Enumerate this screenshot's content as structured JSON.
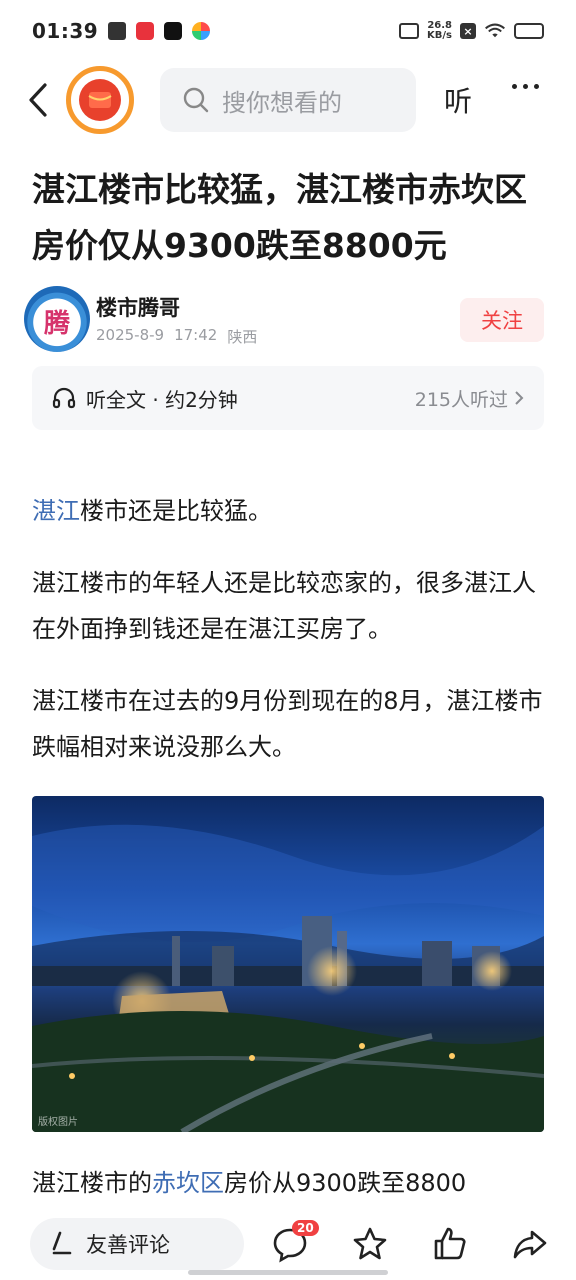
{
  "status_bar": {
    "time": "01:39",
    "speed_value": "26.8",
    "speed_unit": "KB/s"
  },
  "nav": {
    "search_placeholder": "搜你想看的",
    "listen_label": "听"
  },
  "article": {
    "title": "湛江楼市比较猛，湛江楼市赤坎区房价仅从9300跌至8800元",
    "author": {
      "name": "楼市腾哥",
      "date": "2025-8-9",
      "time": "17:42",
      "location": "陕西",
      "avatar_char": "腾"
    },
    "follow_label": "关注",
    "listen_bar": {
      "label": "听全文 · 约2分钟",
      "count": "215人听过"
    },
    "paragraphs": {
      "p1_link": "湛江",
      "p1_rest": "楼市还是比较猛。",
      "p2": "湛江楼市的年轻人还是比较恋家的，很多湛江人在外面挣到钱还是在湛江买房了。",
      "p3": "湛江楼市在过去的9月份到现在的8月，湛江楼市跌幅相对来说没那么大。",
      "p5_pre": "湛江楼市的",
      "p5_link": "赤坎区",
      "p5_post": "房价从9300跌至8800"
    },
    "image_watermark": "版权图片"
  },
  "bottom_bar": {
    "comment_label": "友善评论",
    "comment_count": "20"
  },
  "colors": {
    "accent_red": "#f04142",
    "link_blue": "#3f6db4",
    "logo_orange": "#f79a2e"
  }
}
